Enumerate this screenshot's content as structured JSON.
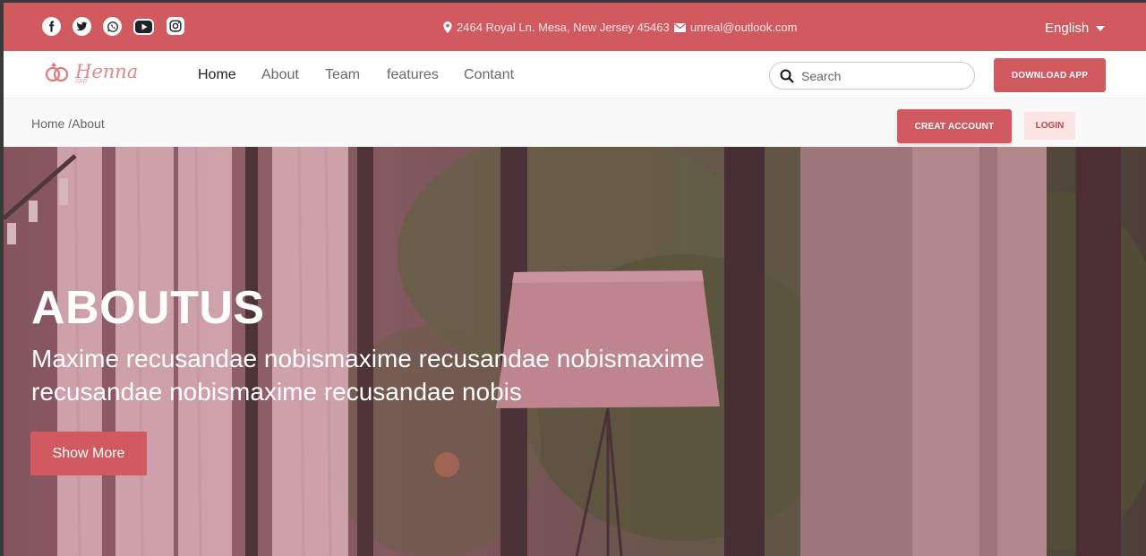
{
  "topbar": {
    "social_icons": [
      "facebook-icon",
      "twitter-icon",
      "whatsapp-icon",
      "youtube-icon",
      "instagram-icon"
    ],
    "address": "2464 Royal Ln. Mesa, New Jersey 45463",
    "email": "unreal@outlook.com",
    "language": "English"
  },
  "brand": {
    "name": "Henna",
    "tagline": "app"
  },
  "nav": {
    "links": [
      "Home",
      "About",
      "Team",
      "features",
      "Contant"
    ],
    "active": "Home",
    "search_placeholder": "Search",
    "download_label": "DOWNLOAD APP"
  },
  "breadcrumb": {
    "text": "Home /About"
  },
  "auth": {
    "create_label": "CREAT ACCOUNT",
    "login_label": "LOGIN"
  },
  "hero": {
    "title": "ABOUTUS",
    "subtitle": "Maxime recusandae nobismaxime recusandae nobismaxime recusandae nobismaxime recusandae nobis",
    "button_label": "Show More"
  },
  "colors": {
    "accent": "#d05a5f",
    "login_bg": "#fbe4e3"
  }
}
